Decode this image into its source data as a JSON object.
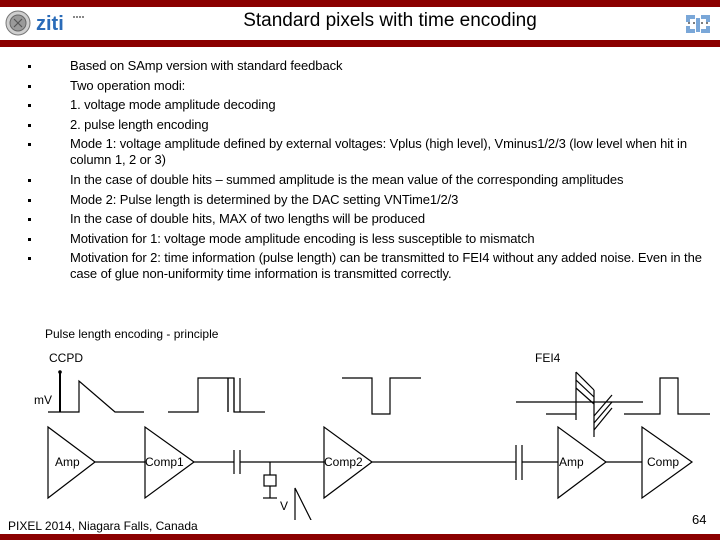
{
  "header": {
    "title": "Standard pixels with time encoding",
    "left_logo": "ziti",
    "brand_color": "#8b0000",
    "logo_blue": "#2a6bb8"
  },
  "bullets": [
    "Based on SAmp version with standard feedback",
    "Two operation modi:",
    "1. voltage mode amplitude decoding",
    "2. pulse length encoding",
    "Mode 1: voltage amplitude defined by external voltages: Vplus (high level), Vminus1/2/3 (low level when hit in column 1, 2 or 3)",
    "In the case of double hits – summed amplitude is the mean value of the corresponding amplitudes",
    "Mode 2: Pulse length is determined by the DAC setting VNTime1/2/3",
    "In the case of double hits, MAX of two lengths will be produced",
    "Motivation for 1: voltage mode amplitude encoding is less susceptible to mismatch",
    "Motivation for 2: time information (pulse length) can be transmitted to FEI4 without any added noise. Even in the case of glue non-uniformity time information is transmitted correctly."
  ],
  "diagram": {
    "title": "Pulse length encoding - principle",
    "labels": {
      "ccpd": "CCPD",
      "fei4": "FEI4",
      "mv": "mV",
      "v": "V"
    },
    "blocks": [
      "Amp",
      "Comp1",
      "Comp2",
      "Amp",
      "Comp"
    ]
  },
  "footer": {
    "conference": "PIXEL 2014, Niagara Falls, Canada",
    "page_number": "64"
  }
}
